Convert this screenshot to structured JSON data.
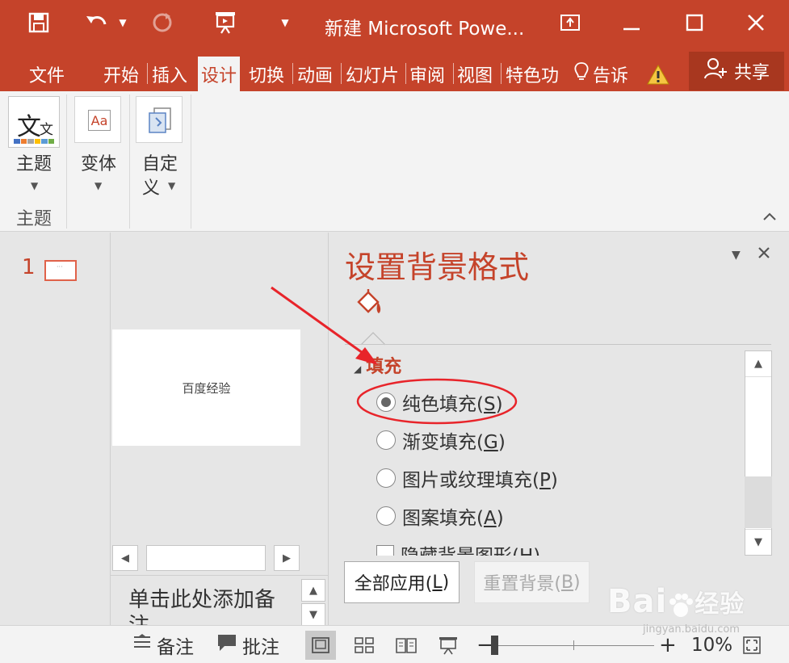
{
  "window": {
    "title": "新建 Microsoft Powe...",
    "accent": "#c5432a"
  },
  "quick_access": {
    "save_icon": "save-icon",
    "undo_icon": "undo-icon",
    "redo_icon": "redo-icon",
    "present_icon": "present-icon",
    "customize_icon": "chevron-down-icon"
  },
  "tabs": [
    {
      "label": "文件"
    },
    {
      "label": "开始"
    },
    {
      "label": "插入"
    },
    {
      "label": "设计",
      "active": true
    },
    {
      "label": "切换"
    },
    {
      "label": "动画"
    },
    {
      "label": "幻灯片"
    },
    {
      "label": "审阅"
    },
    {
      "label": "视图"
    },
    {
      "label": "特色功"
    },
    {
      "label": "告诉"
    }
  ],
  "share": {
    "label": "共享"
  },
  "ribbon": {
    "themes_label": "主题",
    "variants_label": "变体",
    "customize_label_1": "自定",
    "customize_label_2": "义",
    "group_themes": "主题",
    "theme_icon_text_big": "文",
    "theme_icon_text_small": "文",
    "variant_icon_text": "Aa"
  },
  "slides_pane": {
    "slide_number": "1",
    "thumb_text": "···"
  },
  "slide": {
    "text": "百度经验"
  },
  "notes": {
    "placeholder": "单击此处添加备注"
  },
  "format_pane": {
    "title": "设置背景格式",
    "section": "填充",
    "options": [
      {
        "label": "纯色填充(",
        "key": "S",
        "end": ")",
        "selected": true
      },
      {
        "label": "渐变填充(",
        "key": "G",
        "end": ")",
        "selected": false
      },
      {
        "label": "图片或纹理填充(",
        "key": "P",
        "end": ")",
        "selected": false
      },
      {
        "label": "图案填充(",
        "key": "A",
        "end": ")",
        "selected": false
      }
    ],
    "hide_graphics": {
      "label": "隐藏背景图形(H)"
    },
    "apply_all": {
      "label": "全部应用(",
      "key": "L",
      "end": ")"
    },
    "reset": {
      "label": "重置背景(",
      "key": "B",
      "end": ")"
    }
  },
  "status": {
    "notes_label": "备注",
    "comments_label": "批注",
    "zoom": "10%"
  },
  "watermark": {
    "brand": "Bai",
    "brand2": "经验",
    "url": "jingyan.baidu.com"
  }
}
